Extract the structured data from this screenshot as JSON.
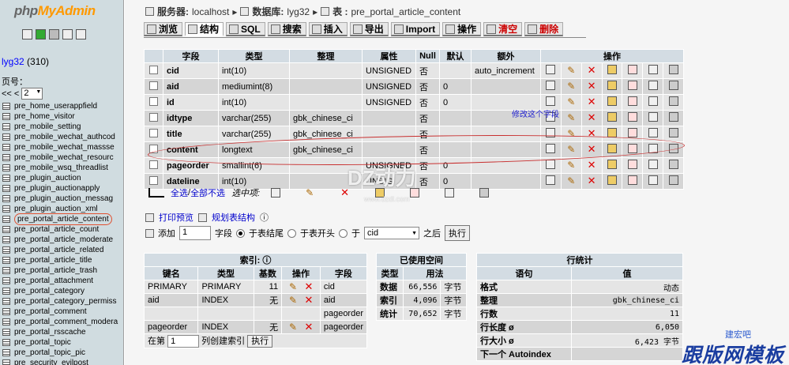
{
  "logo": {
    "part1": "php",
    "part2": "MyAdmin"
  },
  "left": {
    "db_name": "lyg32",
    "db_count": "(310)",
    "page_label": "页号：",
    "pager_prev": "<< <",
    "page_value": "2",
    "tables": [
      "pre_home_userappfield",
      "pre_home_visitor",
      "pre_mobile_setting",
      "pre_mobile_wechat_authcod",
      "pre_mobile_wechat_massse",
      "pre_mobile_wechat_resourc",
      "pre_mobile_wsq_threadlist",
      "pre_plugin_auction",
      "pre_plugin_auctionapply",
      "pre_plugin_auction_messag",
      "pre_plugin_auction_xml",
      "pre_portal_article_content",
      "pre_portal_article_count",
      "pre_portal_article_moderate",
      "pre_portal_article_related",
      "pre_portal_article_title",
      "pre_portal_article_trash",
      "pre_portal_attachment",
      "pre_portal_category",
      "pre_portal_category_permiss",
      "pre_portal_comment",
      "pre_portal_comment_modera",
      "pre_portal_rsscache",
      "pre_portal_topic",
      "pre_portal_topic_pic",
      "pre_security_evilpost"
    ]
  },
  "crumb": {
    "server_label": "服务器:",
    "server": "localhost",
    "db_label": "数据库:",
    "db": "lyg32",
    "table_label": "表 :",
    "table": "pre_portal_article_content"
  },
  "tabs": [
    "浏览",
    "结构",
    "SQL",
    "搜索",
    "插入",
    "导出",
    "Import",
    "操作",
    "清空",
    "删除"
  ],
  "structure": {
    "headers": [
      "字段",
      "类型",
      "整理",
      "属性",
      "Null",
      "默认",
      "额外",
      "操作"
    ],
    "rows": [
      {
        "field": "cid",
        "type": "int(10)",
        "collation": "",
        "attr": "UNSIGNED",
        "null": "否",
        "default": "",
        "extra": "auto_increment"
      },
      {
        "field": "aid",
        "type": "mediumint(8)",
        "collation": "",
        "attr": "UNSIGNED",
        "null": "否",
        "default": "0",
        "extra": ""
      },
      {
        "field": "id",
        "type": "int(10)",
        "collation": "",
        "attr": "UNSIGNED",
        "null": "否",
        "default": "0",
        "extra": ""
      },
      {
        "field": "idtype",
        "type": "varchar(255)",
        "collation": "gbk_chinese_ci",
        "attr": "",
        "null": "否",
        "default": "",
        "extra": ""
      },
      {
        "field": "title",
        "type": "varchar(255)",
        "collation": "gbk_chinese_ci",
        "attr": "",
        "null": "否",
        "default": "",
        "extra": ""
      },
      {
        "field": "content",
        "type": "longtext",
        "collation": "gbk_chinese_ci",
        "attr": "",
        "null": "否",
        "default": "",
        "extra": ""
      },
      {
        "field": "pageorder",
        "type": "smallint(6)",
        "collation": "",
        "attr": "UNSIGNED",
        "null": "否",
        "default": "0",
        "extra": ""
      },
      {
        "field": "dateline",
        "type": "int(10)",
        "collation": "",
        "attr": "UNSIG",
        "null": "否",
        "default": "0",
        "extra": ""
      }
    ]
  },
  "selection": {
    "check_all": "全选",
    "sep": " / ",
    "uncheck_all": "全部不选",
    "with_selected": "选中项:"
  },
  "print": {
    "print_view": "打印预览",
    "relation_view": "规划表结构"
  },
  "add_field": {
    "add_label": "添加",
    "count": "1",
    "field_label": "字段",
    "opt_end": "于表结尾",
    "opt_start": "于表开头",
    "opt_after": "于",
    "after_col": "cid",
    "after_label": "之后",
    "go": "执行"
  },
  "indexes": {
    "title": "索引:",
    "headers": [
      "键名",
      "类型",
      "基数",
      "操作",
      "字段"
    ],
    "rows": [
      {
        "key": "PRIMARY",
        "type": "PRIMARY",
        "card": "11",
        "field": "cid"
      },
      {
        "key": "aid",
        "type": "INDEX",
        "card": "无",
        "field": "aid"
      },
      {
        "key": "",
        "type": "",
        "card": "",
        "field": "pageorder"
      },
      {
        "key": "pageorder",
        "type": "INDEX",
        "card": "无",
        "field": "pageorder"
      }
    ],
    "create_prefix": "在第",
    "create_count": "1",
    "create_suffix": "列创建索引",
    "go": "执行"
  },
  "space": {
    "title": "已使用空间",
    "headers": [
      "类型",
      "用法"
    ],
    "rows": [
      {
        "type": "数据",
        "value": "66,556",
        "unit": "字节"
      },
      {
        "type": "索引",
        "value": "4,096",
        "unit": "字节"
      },
      {
        "type": "统计",
        "value": "70,652",
        "unit": "字节"
      }
    ]
  },
  "stats": {
    "title": "行统计",
    "headers": [
      "语句",
      "值"
    ],
    "rows": [
      {
        "k": "格式",
        "v": "动态"
      },
      {
        "k": "整理",
        "v": "gbk_chinese_ci"
      },
      {
        "k": "行数",
        "v": "11"
      },
      {
        "k": "行长度 ø",
        "v": "6,050"
      },
      {
        "k": "行大小 ø",
        "v": "6,423 字节"
      },
      {
        "k": "下一个 Autoindex",
        "v": ""
      }
    ]
  },
  "annotation": "修改这个字段",
  "watermarks": {
    "dz": "DZ动力",
    "dz_url": "www.dzdl.com",
    "gb": "跟版网模板",
    "gb_small": "建宏吧"
  }
}
